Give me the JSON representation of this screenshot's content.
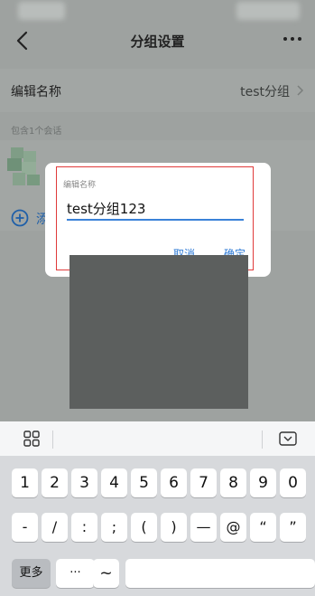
{
  "app": {
    "title": "分组设置",
    "name_row": {
      "label": "编辑名称",
      "value": "test分组"
    },
    "section_caption": "包含1个会话",
    "add_label": "添"
  },
  "dialog": {
    "label": "编辑名称",
    "input_value": "test分组123",
    "cancel_label": "取消",
    "ok_label": "确定"
  },
  "keyboard": {
    "row1": [
      "1",
      "2",
      "3",
      "4",
      "5",
      "6",
      "7",
      "8",
      "9",
      "0"
    ],
    "row2": [
      "-",
      "/",
      ":",
      ";",
      "(",
      ")",
      "—",
      "@",
      "“",
      "”"
    ],
    "row3": {
      "more_label": "更多",
      "ellipsis": "···",
      "tilde": "~"
    }
  },
  "colors": {
    "accent": "#2d7ad6",
    "highlight_frame": "#e03a3a",
    "overlay": "#9ea2a0"
  },
  "icons": [
    "back-icon",
    "more-icon",
    "chevron-right-icon",
    "add-circle-icon",
    "keyboard-grid-icon",
    "keyboard-hide-icon"
  ]
}
